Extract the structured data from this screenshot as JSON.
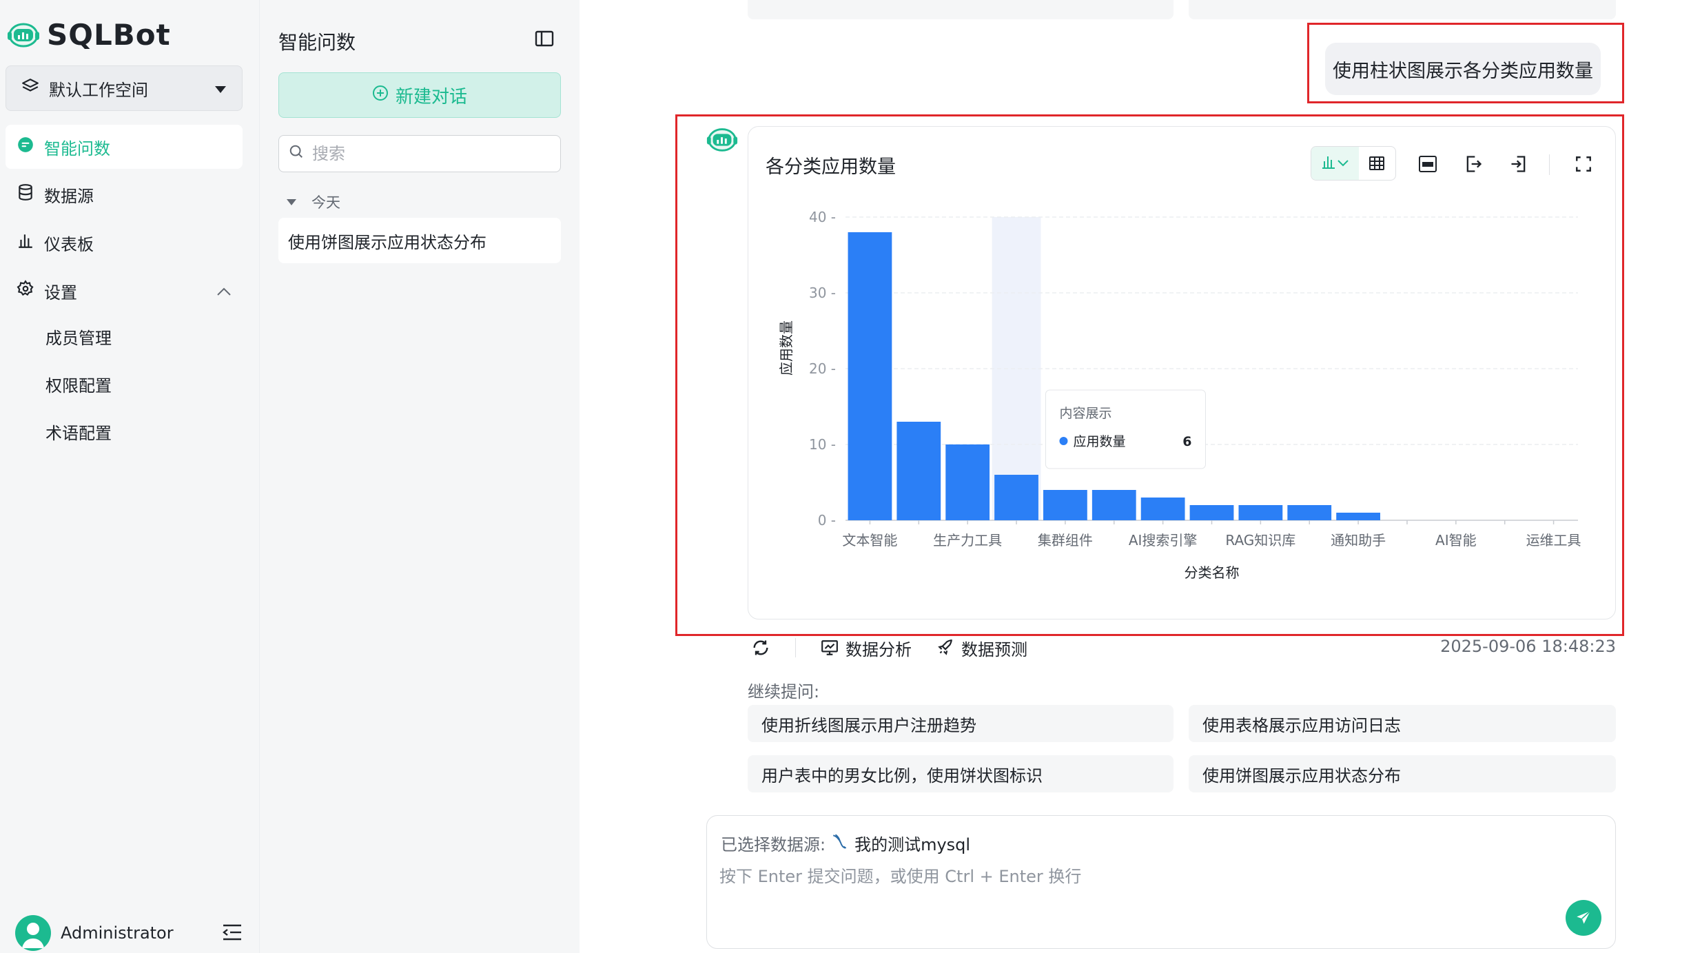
{
  "app": {
    "name": "SQLBot",
    "accent_color": "#1cba90",
    "bar_color": "#2b7ff6"
  },
  "nav": {
    "workspace": "默认工作空间",
    "items": [
      {
        "label": "智能问数",
        "icon": "chat-bubble-icon",
        "active": true
      },
      {
        "label": "数据源",
        "icon": "database-icon"
      },
      {
        "label": "仪表板",
        "icon": "bar-chart-icon"
      },
      {
        "label": "设置",
        "icon": "gear-icon"
      }
    ],
    "settings_children": [
      "成员管理",
      "权限配置",
      "术语配置"
    ],
    "user_name": "Administrator"
  },
  "history": {
    "title": "智能问数",
    "new_chat": "新建对话",
    "search_placeholder": "搜索",
    "group_today": "今天",
    "items": [
      "使用饼图展示应用状态分布"
    ]
  },
  "conversation": {
    "user_message": "使用柱状图展示各分类应用数量",
    "actions": {
      "analysis": "数据分析",
      "predict": "数据预测"
    },
    "timestamp": "2025-09-06 18:48:23",
    "continue_label": "继续提问:",
    "suggestions": [
      "使用折线图展示用户注册趋势",
      "使用表格展示应用访问日志",
      "用户表中的男女比例，使用饼状图标识",
      "使用饼图展示应用状态分布"
    ]
  },
  "composer": {
    "datasource_label": "已选择数据源:",
    "datasource_name": "我的测试mysql",
    "placeholder": "按下 Enter 提交问题，或使用 Ctrl + Enter 换行"
  },
  "chart_data": {
    "type": "bar",
    "title": "各分类应用数量",
    "xlabel": "分类名称",
    "ylabel": "应用数量",
    "ylim": [
      0,
      40
    ],
    "yticks": [
      0,
      10,
      20,
      30,
      40
    ],
    "categories": [
      "文本智能",
      "",
      "生产力工具",
      "",
      "集群组件",
      "",
      "AI搜索引擎",
      "",
      "RAG知识库",
      "",
      "通知助手",
      "",
      "AI智能",
      "",
      "运维工具"
    ],
    "series": [
      {
        "name": "应用数量",
        "values": [
          38,
          13,
          10,
          6,
          4,
          4,
          3,
          2,
          2,
          2,
          1,
          0,
          0,
          0,
          0
        ]
      }
    ],
    "grid": true,
    "legend": "none",
    "tooltip": {
      "title": "内容展示",
      "series": "应用数量",
      "value": "6",
      "index": 3
    }
  }
}
